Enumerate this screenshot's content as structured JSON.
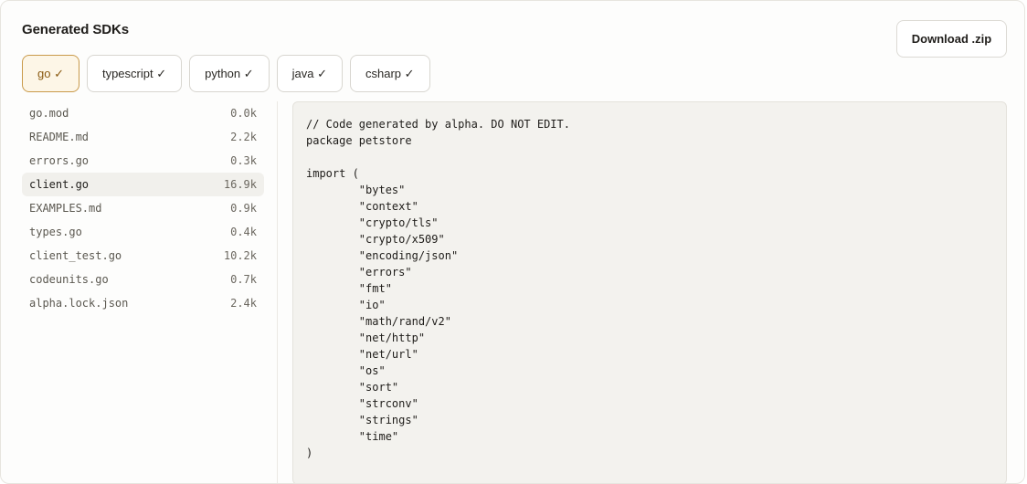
{
  "header": {
    "title": "Generated SDKs",
    "download_label": "Download .zip"
  },
  "tabs": [
    {
      "label": "go ✓",
      "active": true
    },
    {
      "label": "typescript ✓",
      "active": false
    },
    {
      "label": "python ✓",
      "active": false
    },
    {
      "label": "java ✓",
      "active": false
    },
    {
      "label": "csharp ✓",
      "active": false
    }
  ],
  "files": [
    {
      "name": "go.mod",
      "size": "0.0k",
      "selected": false
    },
    {
      "name": "README.md",
      "size": "2.2k",
      "selected": false
    },
    {
      "name": "errors.go",
      "size": "0.3k",
      "selected": false
    },
    {
      "name": "client.go",
      "size": "16.9k",
      "selected": true
    },
    {
      "name": "EXAMPLES.md",
      "size": "0.9k",
      "selected": false
    },
    {
      "name": "types.go",
      "size": "0.4k",
      "selected": false
    },
    {
      "name": "client_test.go",
      "size": "10.2k",
      "selected": false
    },
    {
      "name": "codeunits.go",
      "size": "0.7k",
      "selected": false
    },
    {
      "name": "alpha.lock.json",
      "size": "2.4k",
      "selected": false
    }
  ],
  "code": "// Code generated by alpha. DO NOT EDIT.\npackage petstore\n\nimport (\n\t\"bytes\"\n\t\"context\"\n\t\"crypto/tls\"\n\t\"crypto/x509\"\n\t\"encoding/json\"\n\t\"errors\"\n\t\"fmt\"\n\t\"io\"\n\t\"math/rand/v2\"\n\t\"net/http\"\n\t\"net/url\"\n\t\"os\"\n\t\"sort\"\n\t\"strconv\"\n\t\"strings\"\n\t\"time\"\n)",
  "colors": {
    "active_tab_border": "#c99a4a",
    "active_tab_bg": "#fdf6e7",
    "active_tab_text": "#8a5a12",
    "code_bg": "#f3f2ee"
  }
}
